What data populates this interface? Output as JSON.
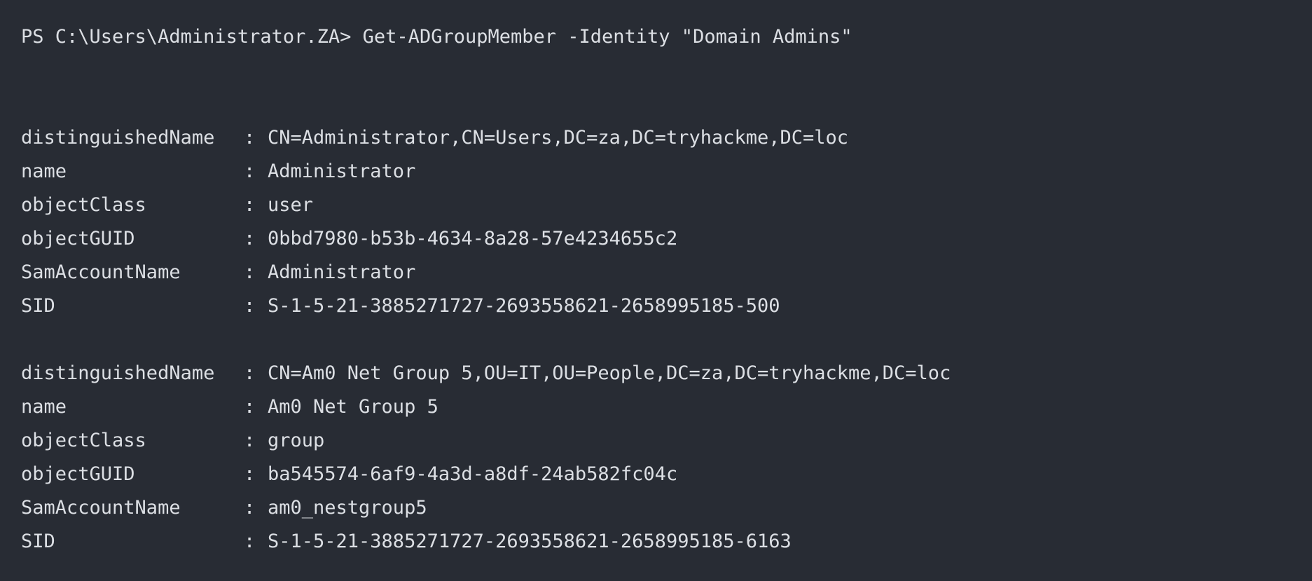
{
  "terminal": {
    "prompt": "PS C:\\Users\\Administrator.ZA>",
    "command": " Get-ADGroupMember -Identity \"Domain Admins\"",
    "separator": ":",
    "records": [
      {
        "fields": [
          {
            "key": "distinguishedName",
            "value": "CN=Administrator,CN=Users,DC=za,DC=tryhackme,DC=loc"
          },
          {
            "key": "name",
            "value": "Administrator"
          },
          {
            "key": "objectClass",
            "value": "user"
          },
          {
            "key": "objectGUID",
            "value": "0bbd7980-b53b-4634-8a28-57e4234655c2"
          },
          {
            "key": "SamAccountName",
            "value": "Administrator"
          },
          {
            "key": "SID",
            "value": "S-1-5-21-3885271727-2693558621-2658995185-500"
          }
        ]
      },
      {
        "fields": [
          {
            "key": "distinguishedName",
            "value": "CN=Am0 Net Group 5,OU=IT,OU=People,DC=za,DC=tryhackme,DC=loc"
          },
          {
            "key": "name",
            "value": "Am0 Net Group 5"
          },
          {
            "key": "objectClass",
            "value": "group"
          },
          {
            "key": "objectGUID",
            "value": "ba545574-6af9-4a3d-a8df-24ab582fc04c"
          },
          {
            "key": "SamAccountName",
            "value": "am0_nestgroup5"
          },
          {
            "key": "SID",
            "value": "S-1-5-21-3885271727-2693558621-2658995185-6163"
          }
        ]
      }
    ]
  }
}
